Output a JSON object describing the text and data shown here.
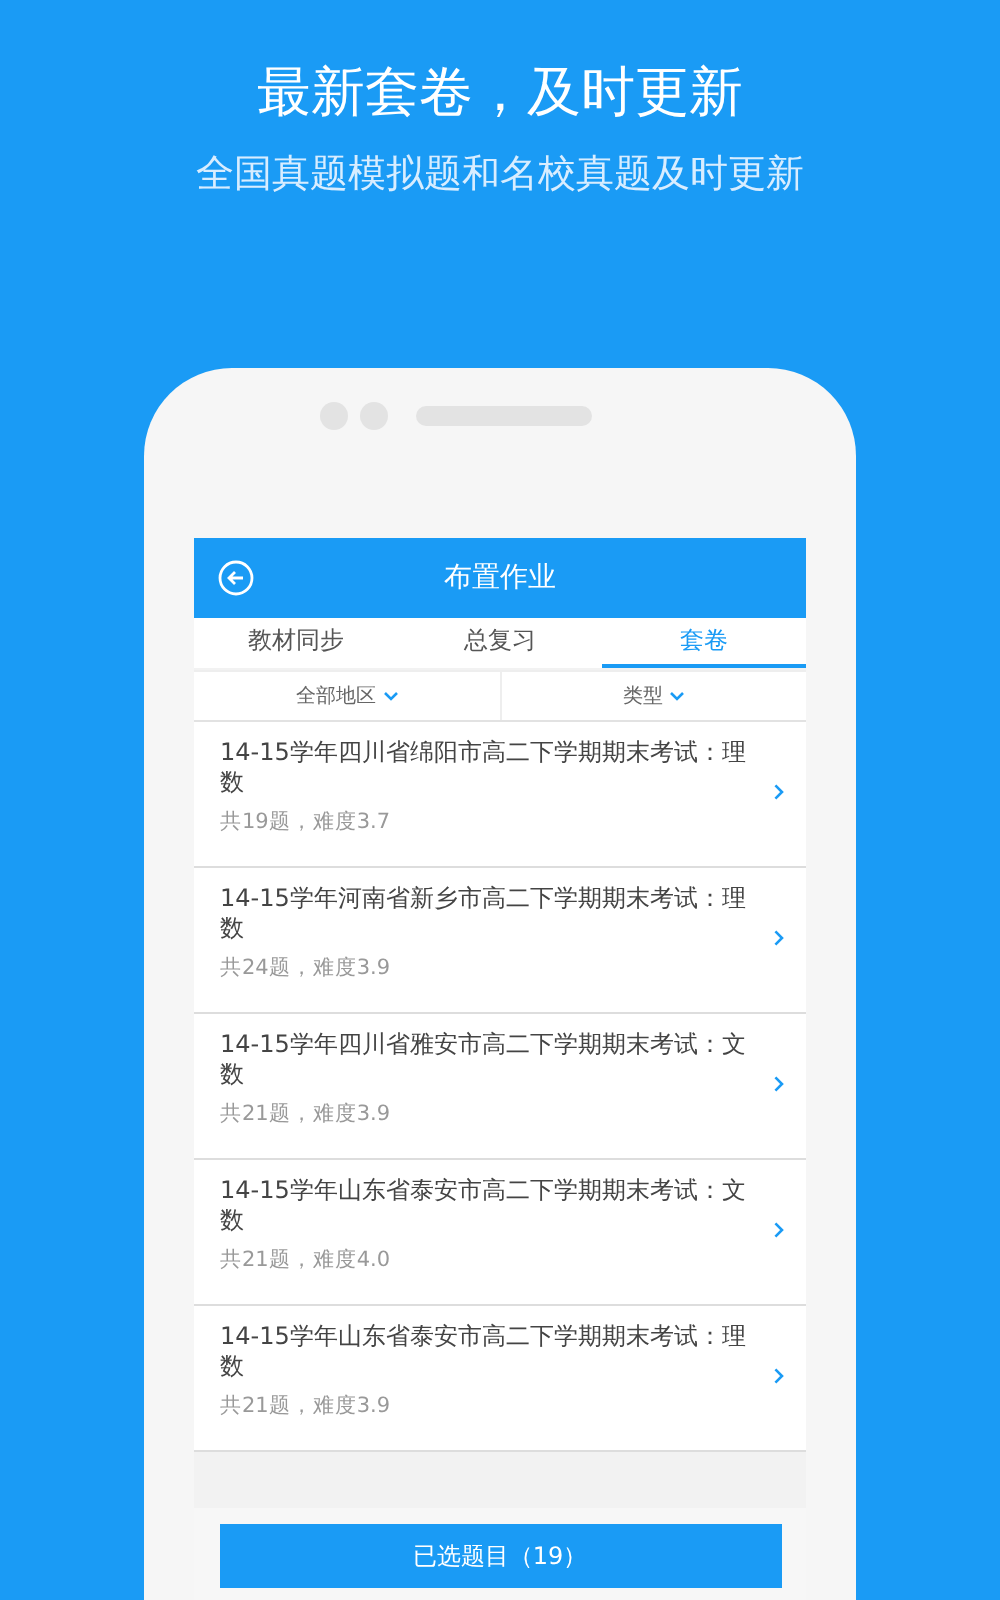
{
  "headline": "最新套卷，及时更新",
  "subheadline": "全国真题模拟题和名校真题及时更新",
  "app": {
    "title": "布置作业",
    "tabs": [
      {
        "label": "教材同步",
        "selected": false
      },
      {
        "label": "总复习",
        "selected": false
      },
      {
        "label": "套卷",
        "selected": true
      }
    ],
    "filters": [
      {
        "label": "全部地区"
      },
      {
        "label": "类型"
      }
    ],
    "papers": [
      {
        "title": "14-15学年四川省绵阳市高二下学期期末考试：理数",
        "meta": "共19题，难度3.7"
      },
      {
        "title": "14-15学年河南省新乡市高二下学期期末考试：理数",
        "meta": "共24题，难度3.9"
      },
      {
        "title": "14-15学年四川省雅安市高二下学期期末考试：文数",
        "meta": "共21题，难度3.9"
      },
      {
        "title": "14-15学年山东省泰安市高二下学期期末考试：文数",
        "meta": "共21题，难度4.0"
      },
      {
        "title": "14-15学年山东省泰安市高二下学期期末考试：理数",
        "meta": "共21题，难度3.9"
      }
    ],
    "selected_button": "已选题目（19）"
  }
}
